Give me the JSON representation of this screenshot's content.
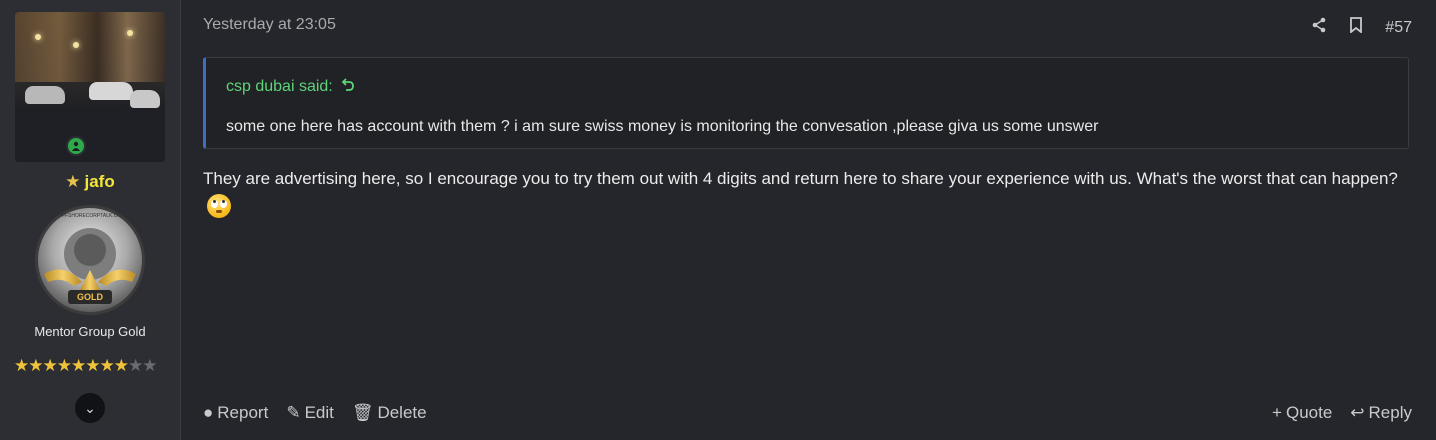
{
  "user": {
    "username": "jafo",
    "title": "Mentor Group Gold",
    "rating": {
      "filled": 8,
      "total": 10
    },
    "badge_text": "GOLD",
    "badge_ring_text": "OFFSHORECORPTALK.COM"
  },
  "post": {
    "date": "Yesterday at 23:05",
    "number": "#57",
    "quote": {
      "attribution": "csp dubai said:",
      "text": "some one here has account with them ? i am sure swiss money is monitoring the convesation ,please giva us some unswer"
    },
    "message": "They are advertising here, so I encourage you to try them out with 4 digits and return here to share your experience with us. What's the worst that can happen?",
    "actions_left": [
      "Report",
      "Edit",
      "Delete"
    ],
    "actions_right": [
      "Quote",
      "Reply"
    ]
  },
  "icons": {
    "share": "share-icon",
    "bookmark": "bookmark-icon",
    "quote_jump": "undo-arrow-icon",
    "report": "warning-circle-icon",
    "edit": "pencil-icon",
    "delete": "trash-icon",
    "quote": "plus-icon",
    "reply": "reply-arrow-icon",
    "expand": "chevron-down-icon"
  },
  "colors": {
    "background": "#25262b",
    "sidebar": "#2d2e33",
    "username": "#f2e63a",
    "quote_attribution": "#5fd37a",
    "quote_border": "#3f6fbf",
    "online": "#2dab4a"
  }
}
